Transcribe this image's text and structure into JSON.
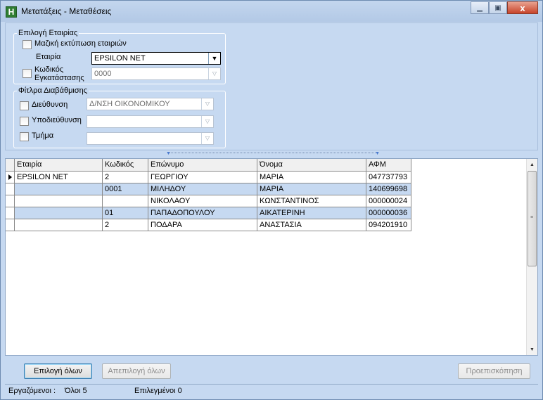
{
  "window": {
    "title": "Μετατάξεις - Μεταθέσεις",
    "icon_glyph": "H",
    "minimize_icon": "minimize-icon",
    "restore_icon": "restore-icon",
    "close_glyph": "x"
  },
  "company_group": {
    "title": "Επιλογή Εταιρίας",
    "bulk_print_label": "Μαζική εκτύπωση εταιριών",
    "company_label": "Εταιρία",
    "company_value": "EPSILON NET",
    "install_code_label_1": "Κωδικός",
    "install_code_label_2": "Εγκατάστασης",
    "install_code_value": "0000"
  },
  "filter_group": {
    "title": "Φίτλρα Διαβάθμισης",
    "direction_label": "Διεύθυνση",
    "direction_value": "Δ/ΝΣΗ ΟΙΚΟΝΟΜΙΚΟΥ",
    "subdirection_label": "Υποδιεύθυνση",
    "subdirection_value": "",
    "department_label": "Τμήμα",
    "department_value": ""
  },
  "grid": {
    "columns": [
      "Εταιρία",
      "Κωδικός",
      "Επώνυμο",
      "Όνομα",
      "ΑΦΜ"
    ],
    "rows": [
      {
        "company": "EPSILON NET",
        "code": "2",
        "surname": "ΓΕΩΡΓΙΟΥ",
        "name": "ΜΑΡΙΑ",
        "afm": "047737793"
      },
      {
        "company": "",
        "code": "0001",
        "surname": "ΜΙΛΗΔΟΥ",
        "name": "ΜΑΡΙΑ",
        "afm": "140699698"
      },
      {
        "company": "",
        "code": "",
        "surname": "ΝΙΚΟΛΑΟΥ",
        "name": "ΚΩΝΣΤΑΝΤΙΝΟΣ",
        "afm": "000000024"
      },
      {
        "company": "",
        "code": "01",
        "surname": "ΠΑΠΑΔΟΠΟΥΛΟΥ",
        "name": "ΑΙΚΑΤΕΡΙΝΗ",
        "afm": "000000036"
      },
      {
        "company": "",
        "code": "2",
        "surname": "ΠΟΔΑΡΑ",
        "name": "ΑΝΑΣΤΑΣΙΑ",
        "afm": "094201910"
      }
    ]
  },
  "buttons": {
    "select_all": "Επιλογή όλων",
    "deselect_all": "Απεπιλογή όλων",
    "preview": "Προεπισκόπηση"
  },
  "status": {
    "employees_label": "Εργαζόμενοι :",
    "all_count": "Όλοι 5",
    "selected": "Επιλεγμένοι 0"
  },
  "colors": {
    "panel": "#c6d9f1",
    "alt_row": "#c6d9f1"
  }
}
